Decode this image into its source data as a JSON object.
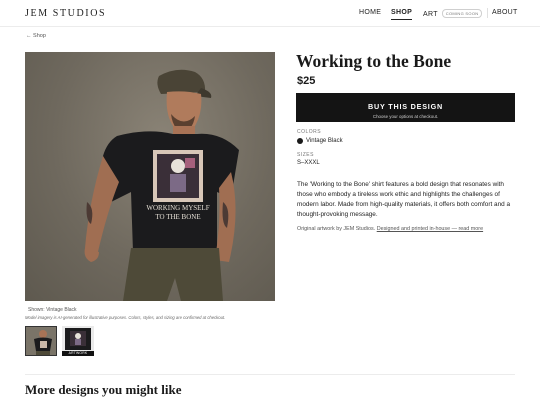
{
  "header": {
    "logo": "JEM STUDIOS",
    "nav": {
      "home": "HOME",
      "shop": "SHOP",
      "art": "ART",
      "art_badge": "COMING SOON",
      "about": "ABOUT"
    }
  },
  "back_link": "← Shop",
  "gallery": {
    "shirt_text_line1": "WORKING MYSELF",
    "shirt_text_line2": "TO THE BONE",
    "shown_caption": "Shown: Vintage Black",
    "disclaimer": "Model imagery is AI-generated for illustrative purposes. Colors, styles, and sizing are confirmed at checkout.",
    "thumb_label": "ARTWORK"
  },
  "product": {
    "title": "Working to the Bone",
    "price": "$25",
    "buy_label": "BUY THIS DESIGN",
    "buy_sub": "Choose your options at checkout.",
    "colors_label": "COLORS",
    "color_value": "Vintage Black",
    "color_hex": "#1a1a1a",
    "sizes_label": "SIZES",
    "sizes_value": "S–XXXL",
    "description": "The 'Working to the Bone' shirt features a bold design that resonates with those who embody a tireless work ethic and highlights the challenges of modern labor. Made from high-quality materials, it offers both comfort and a thought-provoking message.",
    "credit_text": "Original artwork by JEM Studios. ",
    "credit_link": "Designed and printed in-house — read more"
  },
  "more_heading": "More designs you might like"
}
